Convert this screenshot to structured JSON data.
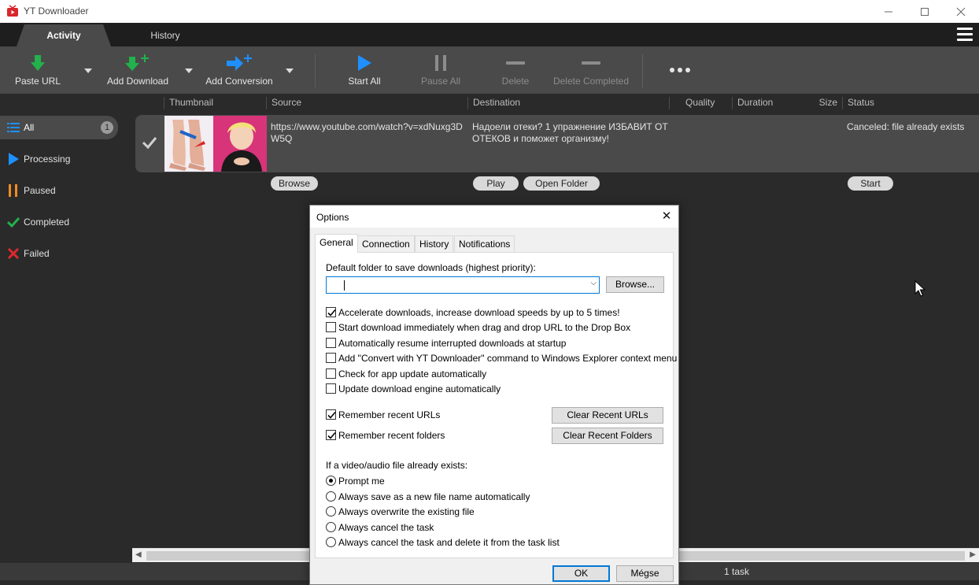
{
  "window": {
    "title": "YT Downloader",
    "controls": [
      "minimize-icon",
      "maximize-icon",
      "close-icon"
    ]
  },
  "tabs": [
    {
      "label": "Activity",
      "active": true
    },
    {
      "label": "History",
      "active": false
    }
  ],
  "toolbar": {
    "paste_url": "Paste URL",
    "add_download": "Add Download",
    "add_conversion": "Add Conversion",
    "start_all": "Start All",
    "pause_all": "Pause All",
    "delete": "Delete",
    "delete_completed": "Delete Completed",
    "more_icon": "ellipsis-icon"
  },
  "sidebar": {
    "items": [
      {
        "label": "All",
        "count": "1",
        "icon": "list-icon",
        "active": true
      },
      {
        "label": "Processing",
        "icon": "play-icon"
      },
      {
        "label": "Paused",
        "icon": "pause-icon"
      },
      {
        "label": "Completed",
        "icon": "check-icon"
      },
      {
        "label": "Failed",
        "icon": "x-icon"
      }
    ]
  },
  "columns": [
    "Thumbnail",
    "Source",
    "Destination",
    "Quality",
    "Duration",
    "Size",
    "Status"
  ],
  "task": {
    "source": "https://www.youtube.com/watch?v=xdNuxg3DW5Q",
    "destination": "Надоели отеки? 1 упражнение ИЗБАВИТ ОТ ОТЕКОВ и поможет организму!",
    "status": "Canceled: file already exists",
    "browse": "Browse",
    "play": "Play",
    "open_folder": "Open Folder",
    "start": "Start"
  },
  "statusbar": {
    "text": "1 task"
  },
  "dialog": {
    "title": "Options",
    "tabs": [
      "General",
      "Connection",
      "History",
      "Notifications"
    ],
    "active_tab": "General",
    "folder_label": "Default folder to save downloads (highest priority):",
    "folder_value": "",
    "browse_button": "Browse...",
    "checkboxes": [
      {
        "label": "Accelerate downloads, increase download speeds by up to 5 times!",
        "checked": true
      },
      {
        "label": "Start download immediately when drag and drop URL to the Drop Box",
        "checked": false
      },
      {
        "label": "Automatically resume interrupted downloads at startup",
        "checked": false
      },
      {
        "label": "Add \"Convert with YT Downloader\" command to Windows Explorer context menu",
        "checked": false
      },
      {
        "label": "Check for app update automatically",
        "checked": false
      },
      {
        "label": "Update download engine automatically",
        "checked": false
      }
    ],
    "remember_urls": {
      "label": "Remember recent URLs",
      "checked": true
    },
    "remember_folders": {
      "label": "Remember recent folders",
      "checked": true
    },
    "clear_urls": "Clear Recent URLs",
    "clear_folders": "Clear Recent Folders",
    "exists_label": "If a video/audio file already exists:",
    "radios": [
      {
        "label": "Prompt me",
        "selected": true
      },
      {
        "label": "Always save as a new file name automatically",
        "selected": false
      },
      {
        "label": "Always overwrite the existing file",
        "selected": false
      },
      {
        "label": "Always cancel the task",
        "selected": false
      },
      {
        "label": "Always cancel the task and delete it from the task list",
        "selected": false
      }
    ],
    "ok": "OK",
    "cancel": "Mégse"
  },
  "colors": {
    "accent_green": "#22b14c",
    "accent_blue": "#1e90ff",
    "paused_orange": "#f08a24",
    "failed_red": "#e0282e"
  }
}
